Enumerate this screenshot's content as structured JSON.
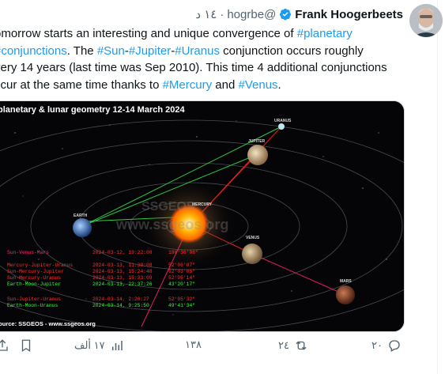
{
  "tweet": {
    "author_name": "Frank Hoogerbeets",
    "handle": "@hogrbe",
    "separator": "·",
    "time": "١٤ د",
    "text_parts": [
      {
        "t": "omorrow starts an interesting and unique convergence of ",
        "tag": false
      },
      {
        "t": "#planetary",
        "tag": true
      },
      {
        "t": "\n",
        "tag": false
      },
      {
        "t": "#conjunctions",
        "tag": true
      },
      {
        "t": ". The ",
        "tag": false
      },
      {
        "t": "#Sun",
        "tag": true
      },
      {
        "t": "-",
        "tag": false
      },
      {
        "t": "#Jupiter",
        "tag": true
      },
      {
        "t": "-",
        "tag": false
      },
      {
        "t": "#Uranus",
        "tag": true
      },
      {
        "t": " conjunction occurs roughly\nvery 14 years (last time was Sep 2010). This time 4 additional conjunctions\nccur at the same time thanks to ",
        "tag": false
      },
      {
        "t": "#Mercury",
        "tag": true
      },
      {
        "t": " and ",
        "tag": false
      },
      {
        "t": "#Venus",
        "tag": true
      },
      {
        "t": ".",
        "tag": false
      }
    ]
  },
  "media": {
    "title": "planetary & lunar geometry 12-14 March 2024",
    "watermark_1": "SSGEOS",
    "watermark_2": "www.ssgeos.org",
    "source": "source: SSGEOS - www.ssgeos.org",
    "planet_labels": {
      "uranus": "URANUS",
      "jupiter": "JUPITER",
      "earth": "EARTH",
      "mercury": "MERCURY",
      "venus": "VENUS",
      "mars": "MARS"
    },
    "table": [
      {
        "name": "Sun-Venus-Mars",
        "date": "2024-03-12, 19:22:08",
        "angle": "180°36'06\"",
        "color": "#ff2a7f"
      },
      {
        "name": "Mercury-Jupiter-Uranus",
        "date": "2024-03-13, 11:30:08",
        "angle": "52°06'07\"",
        "color": "#ff3030"
      },
      {
        "name": "Sun-Mercury-Jupiter",
        "date": "2024-03-13, 15:24:48",
        "angle": "52°03'05\"",
        "color": "#ff3030"
      },
      {
        "name": "Sun-Mercury-Uranus",
        "date": "2024-03-13, 15:33:09",
        "angle": "52°05'14\"",
        "color": "#ff3030"
      },
      {
        "name": "Earth-Moon-Jupiter",
        "date": "2024-03-13, 22:37:26",
        "angle": "43°20'17\"",
        "color": "#33ff33"
      },
      {
        "name": "Sun-Jupiter-Uranus",
        "date": "2024-03-14, 2:20:27",
        "angle": "52°05'32\"",
        "color": "#ff3030"
      },
      {
        "name": "Earth-Moon-Uranus",
        "date": "2024-03-14, 9:25:50",
        "angle": "49°41'34\"",
        "color": "#33ff33"
      }
    ]
  },
  "actions": {
    "replies": "٢٠",
    "retweets": "٢٤",
    "likes": "١٣٨",
    "views": "١٧ ألف"
  },
  "colors": {
    "link": "#1d9bf0",
    "muted": "#536471",
    "verified": "#1d9bf0"
  }
}
